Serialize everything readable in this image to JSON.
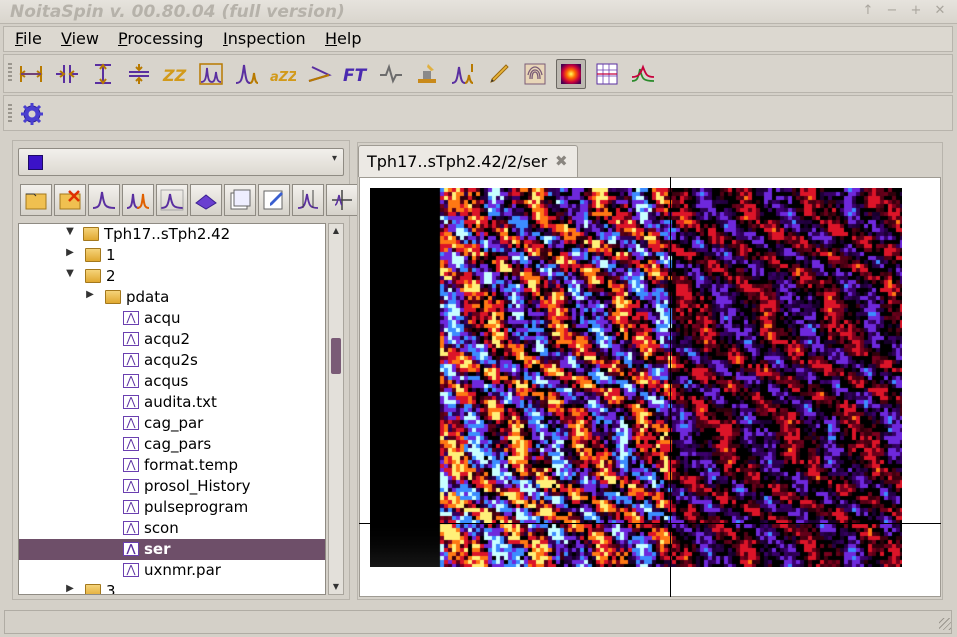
{
  "window": {
    "title": "NoitaSpin v. 00.80.04 (full version)",
    "controls": [
      "↑",
      "−",
      "+",
      "✕"
    ]
  },
  "menu": [
    {
      "key": "F",
      "rest": "ile"
    },
    {
      "key": "V",
      "rest": "iew"
    },
    {
      "key": "P",
      "rest": "rocessing"
    },
    {
      "key": "I",
      "rest": "nspection"
    },
    {
      "key": "H",
      "rest": "elp"
    }
  ],
  "toolbar_icons": [
    "horizontal-expand-icon",
    "vertical-expand-icon",
    "vertical-range-icon",
    "horizontal-compress-icon",
    "zz-icon",
    "peak-box-icon",
    "single-peak-icon",
    "azz-icon",
    "phase-icon",
    "ft-icon",
    "waveform-icon",
    "stamp-icon",
    "peak-pick-icon",
    "pencil-icon",
    "fingerprint-icon",
    "heatmap-view-icon",
    "grid-view-icon",
    "overlay-spectra-icon"
  ],
  "settings_icon": "gear-icon",
  "combo": {
    "swatch_color": "#3b12c8"
  },
  "tree_toolbar_icons": [
    "open-folder-icon",
    "close-folder-icon",
    "spectrum-icon",
    "multi-spectrum-icon",
    "spectrum-add-icon",
    "3d-plot-icon",
    "folder-pages-icon",
    "edit-icon",
    "integral-icon",
    "split-icon"
  ],
  "tree": {
    "root": "Tph17..sTph2.42",
    "items": [
      {
        "label": "1",
        "type": "folder",
        "expander": "▶"
      },
      {
        "label": "2",
        "type": "folder",
        "expander": "▼"
      },
      {
        "label": "pdata",
        "type": "folder",
        "expander": "▶"
      },
      {
        "label": "acqu",
        "type": "file"
      },
      {
        "label": "acqu2",
        "type": "file"
      },
      {
        "label": "acqu2s",
        "type": "file"
      },
      {
        "label": "acqus",
        "type": "file"
      },
      {
        "label": "audita.txt",
        "type": "file"
      },
      {
        "label": "cag_par",
        "type": "file"
      },
      {
        "label": "cag_pars",
        "type": "file"
      },
      {
        "label": "format.temp",
        "type": "file"
      },
      {
        "label": "prosol_History",
        "type": "file"
      },
      {
        "label": "pulseprogram",
        "type": "file"
      },
      {
        "label": "scon",
        "type": "file"
      },
      {
        "label": "ser",
        "type": "file",
        "selected": true
      },
      {
        "label": "uxnmr.par",
        "type": "file"
      },
      {
        "label": "3",
        "type": "folder",
        "expander": "▶"
      }
    ]
  },
  "tab": {
    "label": "Tph17..sTph2.42/2/ser",
    "close": "✖"
  },
  "colors": {
    "selection": "#6e4f69",
    "accent_purple": "#3b12c8"
  }
}
